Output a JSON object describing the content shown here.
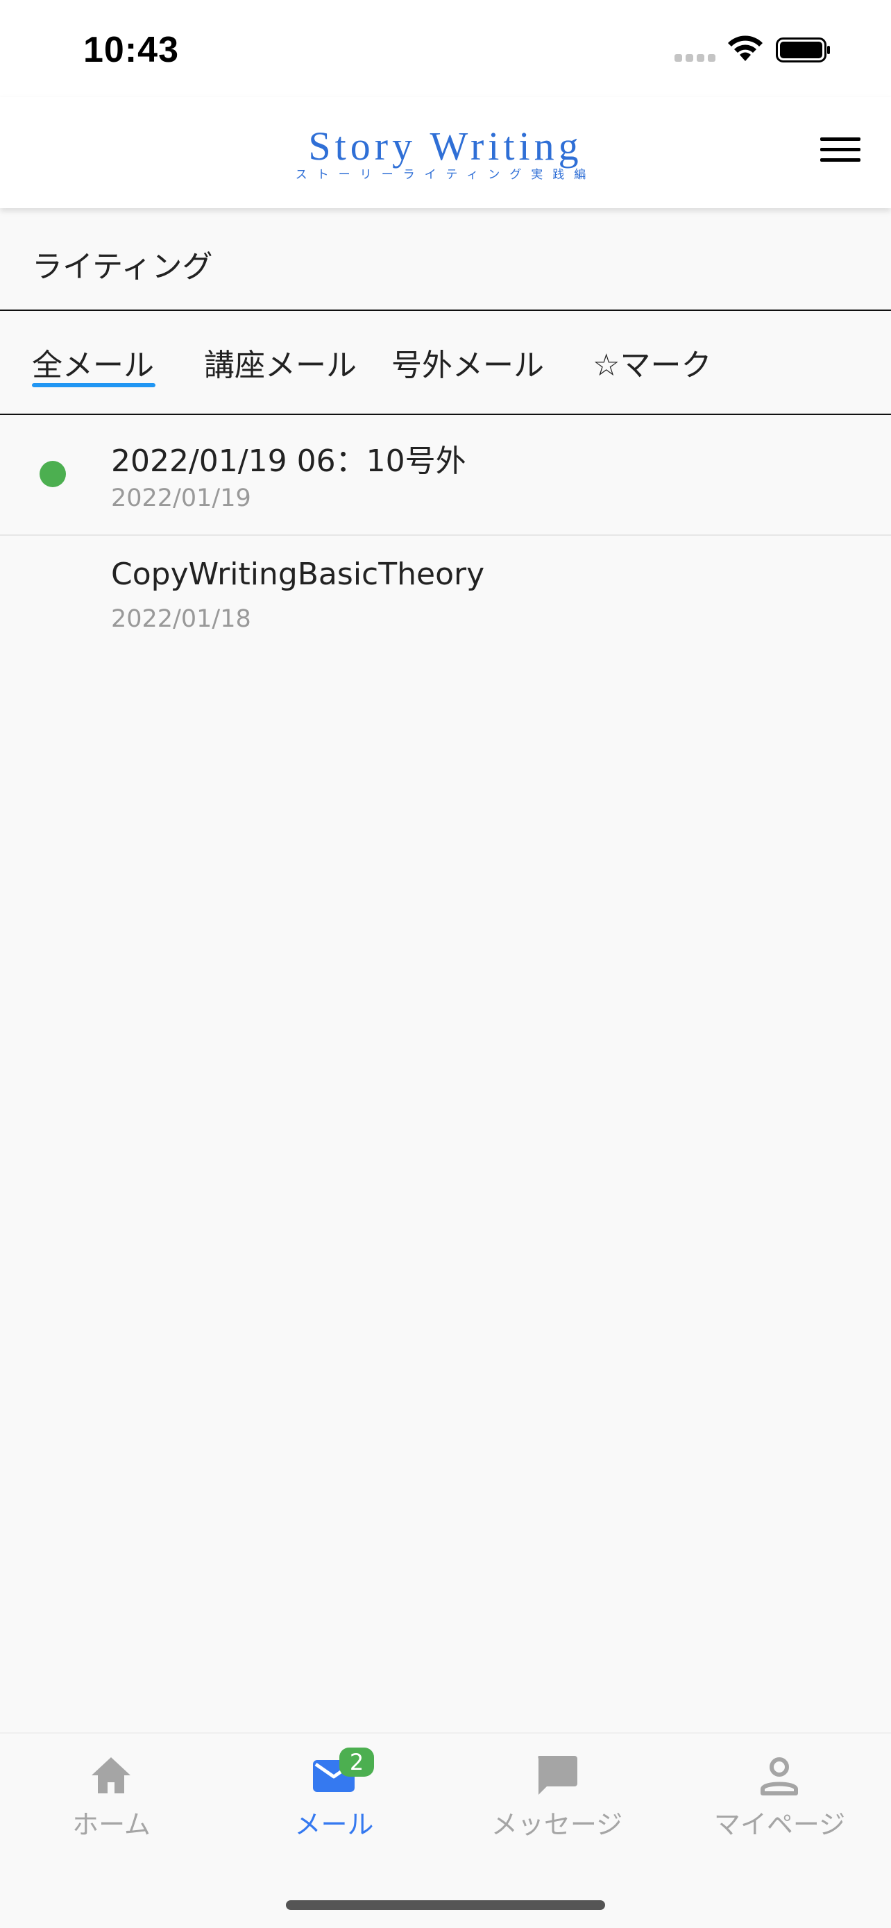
{
  "status_bar": {
    "time": "10:43"
  },
  "header": {
    "logo_title": "Story Writing",
    "logo_subtitle": "ストーリーライティング実践編",
    "brand_color": "#2f6fd6",
    "menu_icon": "hamburger-menu-icon"
  },
  "section": {
    "title": "ライティング"
  },
  "tabs": [
    {
      "label": "全メール",
      "active": true
    },
    {
      "label": "講座メール",
      "active": false
    },
    {
      "label": "号外メール",
      "active": false
    },
    {
      "label": "☆マーク",
      "active": false
    }
  ],
  "tab_accent_color": "#2196f3",
  "mails": [
    {
      "subject": "2022/01/19 06：10号外",
      "date": "2022/01/19",
      "unread": true
    },
    {
      "subject": "CopyWritingBasicTheory",
      "date": "2022/01/18",
      "unread": false
    }
  ],
  "unread_color": "#4caf50",
  "bottom_nav": [
    {
      "label": "ホーム",
      "icon": "home-icon",
      "active": false
    },
    {
      "label": "メール",
      "icon": "mail-icon",
      "active": true,
      "badge": "2"
    },
    {
      "label": "メッセージ",
      "icon": "chat-icon",
      "active": false
    },
    {
      "label": "マイページ",
      "icon": "person-icon",
      "active": false
    }
  ],
  "nav_active_color": "#3579f0",
  "nav_inactive_color": "#a5a5a5"
}
